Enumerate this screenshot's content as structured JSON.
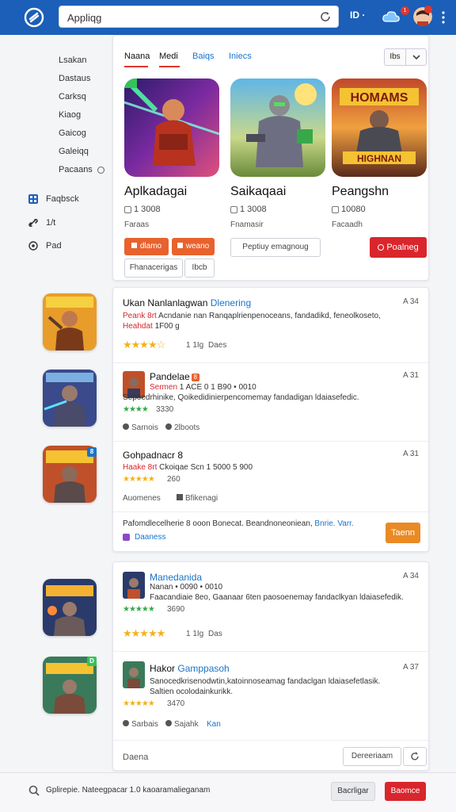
{
  "topbar": {
    "search_value": "Appliqg",
    "lang_label": "ID ·",
    "notif_count": "1",
    "colors": {
      "bar": "#1b5fb8",
      "accent_red": "#d8262c",
      "accent_orange": "#e8622e"
    }
  },
  "sidebar": {
    "links": [
      "Lsakan",
      "Dastaus",
      "Carksq",
      "Kiaog",
      "Gaicog",
      "Galeiqq",
      "Pacaans"
    ],
    "main": [
      {
        "label": "Faqbsck",
        "icon": "grid-icon"
      },
      {
        "label": "1/t",
        "icon": "link-icon"
      },
      {
        "label": "Pad",
        "icon": "target-icon"
      }
    ]
  },
  "featured": {
    "tabs": [
      "Naana",
      "Medi",
      "Baiqs",
      "Iniecs"
    ],
    "view_toggle_label": "Ibs",
    "games": [
      {
        "title": "Aplkadagai",
        "count": "1 3008",
        "sub": "Faraas"
      },
      {
        "title": "Saikaqaai",
        "count": "1 3008",
        "sub": "Fnamasir"
      },
      {
        "title": "Peangshn",
        "count": "10080",
        "sub": "Facaadh"
      }
    ],
    "buttons": {
      "orange_1": "dlamo",
      "orange_2": "weano",
      "outline_1": "Fhanacerigas",
      "outline_2": "Ibcb",
      "outline_3": "Peptiuy emagnoug",
      "red": "Poalneg"
    }
  },
  "list1": {
    "rows": [
      {
        "title": "Ukan Nanlanlagwan",
        "title_accent": "Dlenering",
        "age": "A 34",
        "desc_red": "Peank 8rt",
        "desc": "Acndanie nan Ranqaplrienpenoceans, fandadikd, feneolkoseto,",
        "desc2_red": "Heahdat",
        "desc2": "1F00 g",
        "stars": "★★★★☆",
        "rating": "1 1Ig",
        "rating_label": "Daes"
      },
      {
        "title": "Pandelae",
        "title_badge": "8",
        "age": "A 31",
        "sub_red": "Sermen",
        "sub": "1 ACE 0 1 B90 • 0010",
        "desc": "Sepoedrhinike, Qoikedidinierpencomemay fandadigan ldaiasefedic.",
        "stars_small": "★★★★",
        "small_num": "3330",
        "meta1": "Sarnois",
        "meta2": "2lboots"
      },
      {
        "title": "Gohpadnacr",
        "title_badge": "8",
        "age": "A 31",
        "sub_red": "Haake 8rt",
        "sub": "Ckoiqae Scn 1 5000 5 900",
        "stars_small": "★★★★★",
        "small_num": "260",
        "meta1": "Auomenes",
        "meta2": "Bfikenagi"
      }
    ],
    "footer_text": "Pafomdlecelherie 8 ooon Bonecat. Beandnoneoniean,",
    "footer_link": "Bnrie. Varr.",
    "footer_tag": "Daaness",
    "footer_button": "Taenn"
  },
  "list2": {
    "rows": [
      {
        "title": "Manedanida",
        "age": "A 34",
        "sub": "Nanan  • 0090 • 0010",
        "desc": "Faacandiaie 8eo, Gaanaar 6ten paosoenemay fandaclkyan ldaiasefedik.",
        "stars_small": "★★★★★",
        "small_num": "3690",
        "stars": "★★★★★",
        "rating": "1 1Ig",
        "rating_label": "Das"
      },
      {
        "title": "Hakor",
        "title_accent": "Gamppasoh",
        "age": "A 37",
        "desc": "Sanocedkrisenodwtin,katoinnoseamag fandaclgan ldaiasefetlasik.",
        "desc2": "Saltien ocolodainkurikk.",
        "stars_small": "★★★★★",
        "small_num": "3470",
        "meta1": "Sarbais",
        "meta2": "Sajahk",
        "meta3": "Kan"
      }
    ],
    "footer_text": "Daena",
    "footer_button": "Dereeriaam"
  },
  "bottombar": {
    "text": "Gplirepie. Nateegpacar 1.0 kaoaramalieganam",
    "gray_button": "Bacrligar",
    "red_button": "Baomce"
  }
}
